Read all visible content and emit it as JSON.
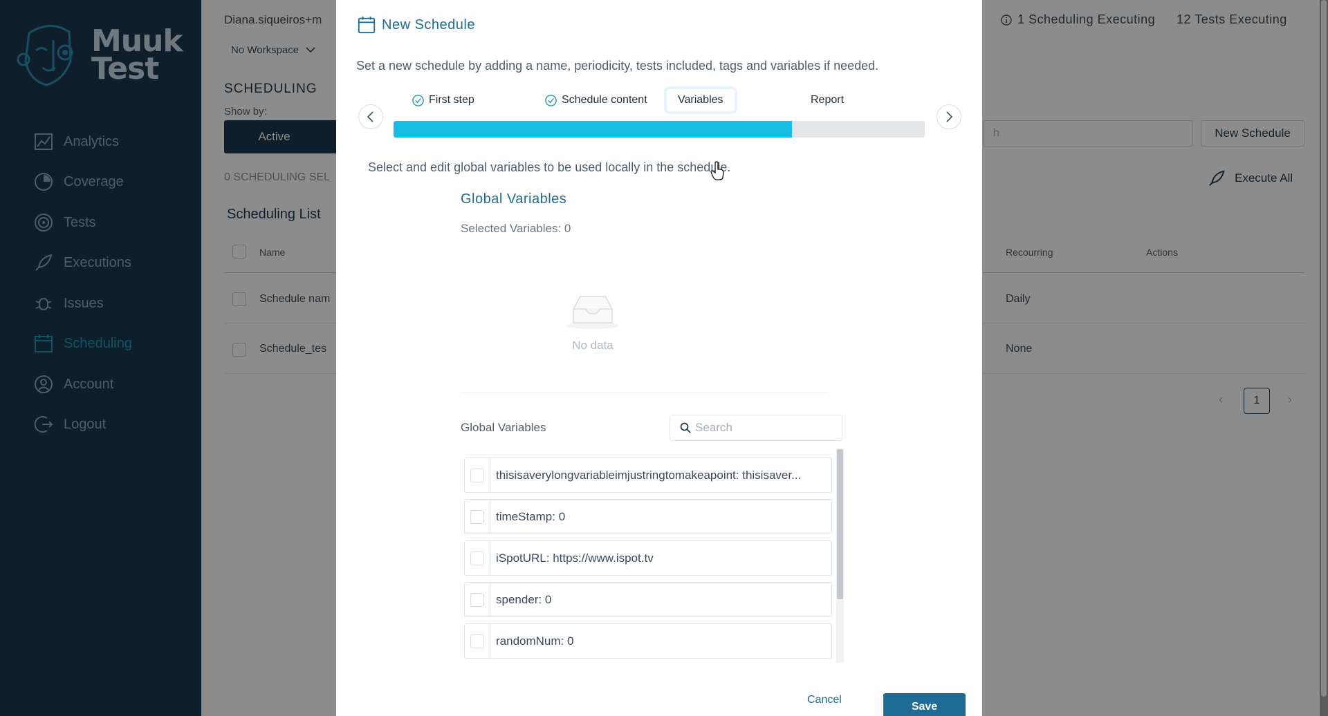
{
  "brand": {
    "name_line1": "Muuk",
    "name_line2": "Test"
  },
  "sidebar": {
    "items": [
      {
        "label": "Analytics",
        "icon": "analytics-icon"
      },
      {
        "label": "Coverage",
        "icon": "coverage-icon"
      },
      {
        "label": "Tests",
        "icon": "tests-icon"
      },
      {
        "label": "Executions",
        "icon": "executions-icon"
      },
      {
        "label": "Issues",
        "icon": "issues-icon"
      },
      {
        "label": "Scheduling",
        "icon": "scheduling-icon",
        "active": true
      },
      {
        "label": "Account",
        "icon": "account-icon"
      },
      {
        "label": "Logout",
        "icon": "logout-icon"
      }
    ]
  },
  "header": {
    "user_email": "Diana.siqueiros+m",
    "workspace": "No Workspace",
    "scheduling_executing": "1 Scheduling Executing",
    "tests_executing": "12 Tests Executing"
  },
  "page": {
    "heading": "SCHEDULING",
    "show_by": "Show by:",
    "tab_active": "Active",
    "selected_count": "0 SCHEDULING SEL",
    "search_placeholder": "h",
    "new_schedule": "New Schedule",
    "execute_all": "Execute All",
    "list_title": "Scheduling List",
    "columns": {
      "name": "Name",
      "recurring": "Recourring",
      "actions": "Actions"
    },
    "rows": [
      {
        "name": "Schedule nam",
        "recurring": "Daily"
      },
      {
        "name": "Schedule_tes",
        "recurring": "None"
      }
    ],
    "pagination": {
      "current": "1"
    }
  },
  "modal": {
    "title": "New Schedule",
    "description": "Set a new schedule by adding a name, periodicity, tests included, tags and variables if needed.",
    "steps": [
      {
        "label": "First step",
        "done": true
      },
      {
        "label": "Schedule content",
        "done": true
      },
      {
        "label": "Variables",
        "current": true
      },
      {
        "label": "Report"
      }
    ],
    "progress_fraction": 0.75,
    "section_description": "Select and edit global variables to be used locally in the schedule.",
    "global_variables_title": "Global Variables",
    "selected_variables": "Selected Variables: 0",
    "empty_text": "No data",
    "list_label": "Global Variables",
    "search_placeholder": "Search",
    "variables": [
      "thisisaverylongvariableimjustringtomakeapoint: thisisaver...",
      "timeStamp: 0",
      "iSpotURL: https://www.ispot.tv",
      "spender: 0",
      "randomNum: 0"
    ],
    "cancel_label": "Cancel",
    "save_label": "Save"
  },
  "colors": {
    "sidebar_bg": "#1b3a4f",
    "accent": "#1e6b96",
    "progress": "#17bde3",
    "active_nav": "#1e98b8"
  }
}
